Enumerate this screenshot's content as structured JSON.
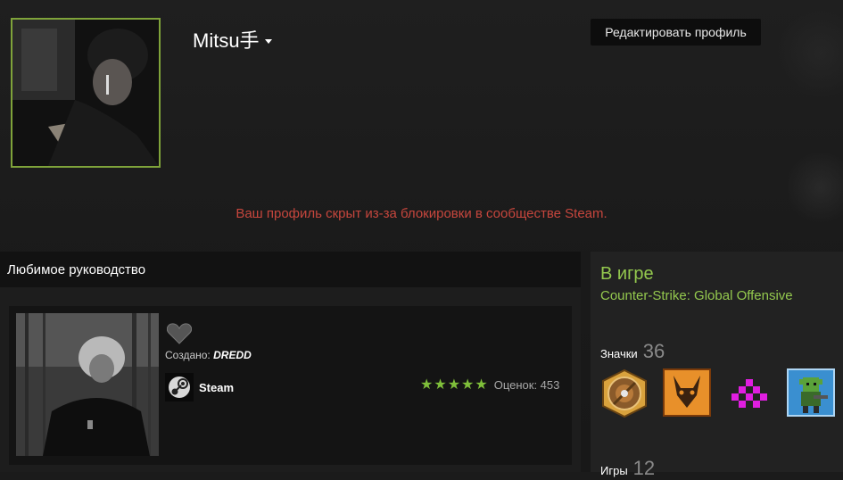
{
  "profile": {
    "persona_name": "Mitsu手",
    "edit_button_label": "Редактировать профиль",
    "private_notice": "Ваш профиль скрыт из-за блокировки в сообществе Steam."
  },
  "showcase": {
    "header": "Любимое руководство",
    "guide": {
      "created_label": "Создано:",
      "author": "DREDD",
      "app_name": "Steam",
      "stars": "★★★★★",
      "rating_label": "Оценок: 453"
    }
  },
  "sidebar": {
    "in_game_title": "В игре",
    "in_game_name": "Counter-Strike: Global Offensive",
    "badges_label": "Значки",
    "badges_count": "36",
    "badges": [
      "shield-badge-icon",
      "fox-badge-icon",
      "pixel-invader-badge-icon",
      "pixel-goblin-badge-icon"
    ],
    "games_label": "Игры",
    "games_count": "12"
  },
  "colors": {
    "accent_green": "#94c94e",
    "avatar_border": "#7fa33a",
    "warning_red": "#c6463d"
  }
}
